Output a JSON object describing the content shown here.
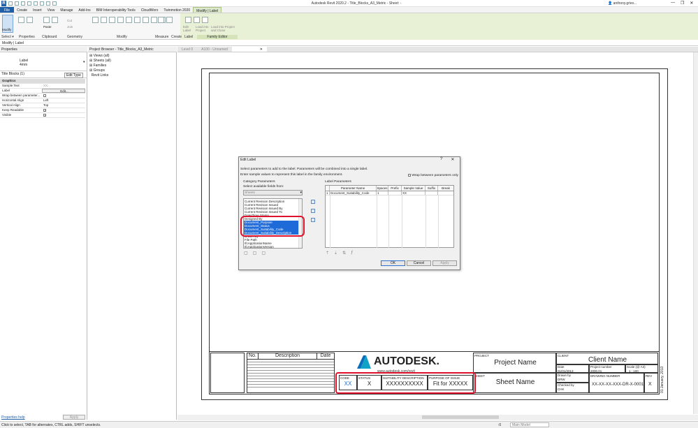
{
  "app": {
    "title": "Autodesk Revit 2020.2 - Title_Blocks_A3_Metric - Sheet: -",
    "user": "anthony.griev...",
    "window_controls": [
      "—",
      "❐",
      "✕"
    ]
  },
  "ribbon": {
    "tabs": [
      "File",
      "Create",
      "Insert",
      "View",
      "Manage",
      "Add-Ins",
      "BIM Interoperability Tools",
      "CloudWorx",
      "Twinmotion 2020",
      "Modify | Label"
    ],
    "active_tab": "Modify | Label",
    "groups": [
      "Select ▾",
      "Properties",
      "Clipboard",
      "Geometry",
      "Modify",
      "Measure",
      "Create",
      "Label",
      "Family Editor"
    ],
    "modify_label": "Modify",
    "cut_label": "Cut",
    "join_label": "Join",
    "paste_label": "Paste",
    "edit_label_btn": "Edit Label",
    "load_into_project": "Load into Project",
    "load_and_close": "Load into Project and Close"
  },
  "option_bar": {
    "text": "Modify | Label"
  },
  "properties": {
    "title": "Properties",
    "type_name": "Label",
    "type_size": "4mm",
    "type_filter": "Title Blocks (1)",
    "edit_type": "Edit Type",
    "rows": [
      {
        "k": "Graphics",
        "v": "",
        "group": true
      },
      {
        "k": "Sample Text",
        "v": "XX..."
      },
      {
        "k": "Label",
        "v": "Edit..."
      },
      {
        "k": "Wrap between parameter...",
        "v": ""
      },
      {
        "k": "Horizontal Align",
        "v": "Left"
      },
      {
        "k": "Vertical Align",
        "v": "Top"
      },
      {
        "k": "Keep Readable",
        "v": ""
      },
      {
        "k": "Visible",
        "v": ""
      }
    ],
    "help_link": "Properties help",
    "apply": "Apply"
  },
  "project_browser": {
    "title": "Project Browser - Title_Blocks_A3_Metric",
    "items": [
      "Views (all)",
      "Sheets (all)",
      "Families",
      "Groups",
      "Revit Links"
    ]
  },
  "view_tabs": [
    {
      "label": "Level 0",
      "active": false
    },
    {
      "label": "A100 - Unnamed",
      "active": false
    },
    {
      "label": "",
      "active": true
    }
  ],
  "title_block": {
    "rev_headers": [
      "No.",
      "Description",
      "Date"
    ],
    "brand": "AUTODESK.",
    "url": "www.autodesk.com/revit",
    "project_label": "PROJECT",
    "project_name": "Project Name",
    "sheet_label": "SHEET",
    "sheet_name": "Sheet Name",
    "client_label": "CLIENT",
    "client_name": "Client Name",
    "date_label": "Date",
    "date_value": "01/01/2013",
    "project_number_label": "Project number",
    "project_number": "2000.01",
    "scale_label": "Scale (@ A3)",
    "scale_value": "1 : 100",
    "drawn_by_label": "Drawn by",
    "drawn_by": "DRW",
    "checked_by_label": "Checked by",
    "checked_by": "CHK",
    "drawing_number_label": "DRAWING NUMBER",
    "drawing_number": "XX-XX-XX-XXX-DR-X-0001",
    "rev_label": "REV",
    "rev_value": "X",
    "code_label": "CODE",
    "code_value": "XX",
    "status_label": "STATUS",
    "status_value": "X",
    "suit_desc_label": "SUITABILITY DESCRIPTION",
    "suit_desc_value": "XXXXXXXXXX",
    "purpose_label": "PURPOSE OF ISSUE",
    "purpose_value": "Fit for XXXXX",
    "vertical_date": "01 January, 2013"
  },
  "dialog": {
    "title": "Edit Label",
    "help": "?",
    "close": "✕",
    "instr1": "Select parameters to add to the label.  Parameters will be combined into a single label.",
    "instr2": "Enter sample values to represent this label in the family environment.",
    "wrap_option": "Wrap between parameters only",
    "category_params": "Category Parameters",
    "select_from": "Select available fields from:",
    "category_select": "Sheets",
    "available": [
      {
        "t": "Current Revision Description",
        "sel": false
      },
      {
        "t": "Current Revision Issued",
        "sel": false
      },
      {
        "t": "Current Revision Issued By",
        "sel": false
      },
      {
        "t": "Current Revision Issued To",
        "sel": false
      },
      {
        "t": "Date/Time Stamp",
        "sel": false
      },
      {
        "t": "Designed By",
        "sel": false
      },
      {
        "t": "Document_Purpose",
        "sel": true
      },
      {
        "t": "Document_Status",
        "sel": true
      },
      {
        "t": "Document_Suitability_Code",
        "sel": true
      },
      {
        "t": "Document_Suitability_Description",
        "sel": true
      },
      {
        "t": "Drawn By",
        "sel": false
      },
      {
        "t": "File Path",
        "sel": false
      },
      {
        "t": "IfcApplicationName",
        "sel": false
      },
      {
        "t": "IfcApplicationVersion",
        "sel": false
      }
    ],
    "label_params": "Label Parameters",
    "grid_headers": [
      "",
      "Parameter Name",
      "Spaces",
      "Prefix",
      "Sample Value",
      "Suffix",
      "Break"
    ],
    "grid_rows": [
      [
        "1",
        "Document_Suitability_Code",
        "1",
        "",
        "XX",
        "",
        ""
      ]
    ],
    "ok": "OK",
    "cancel": "Cancel",
    "apply": "Apply"
  },
  "statusbar": {
    "text": "Click to select, TAB for alternates, CTRL adds, SHIFT unselects.",
    "model": "Main Model",
    "zero": ":0"
  },
  "colors": {
    "accent": "#1f5fa8",
    "highlight": "#e0112b",
    "selection": "#1e6ad8",
    "context_tab": "#e8f0d6"
  }
}
